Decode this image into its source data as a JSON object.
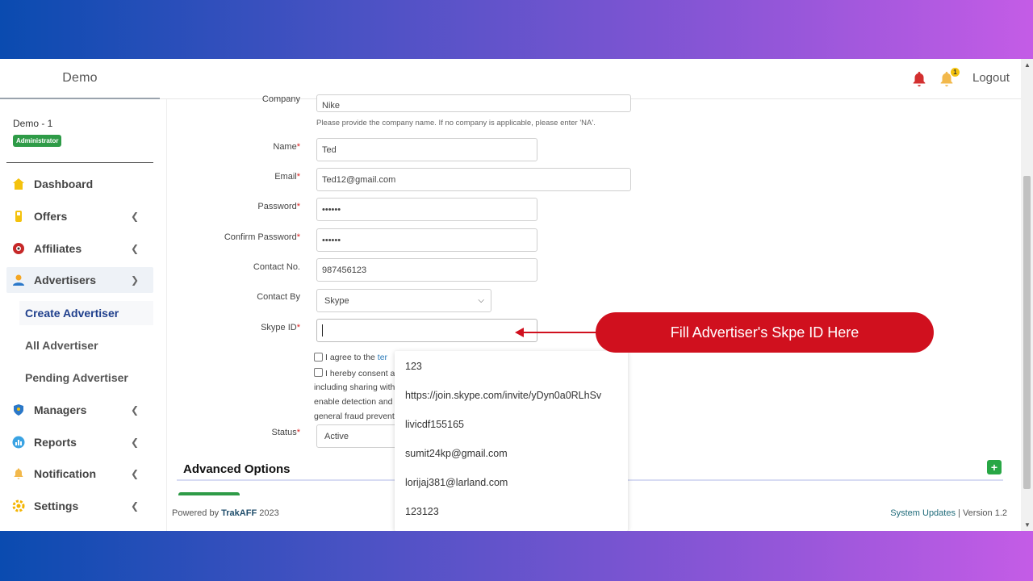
{
  "header": {
    "brand": "Demo",
    "notification_badge": "1",
    "logout_label": "Logout"
  },
  "sidebar": {
    "user_name": "Demo - 1",
    "role": "Administrator",
    "items": [
      {
        "label": "Dashboard",
        "icon": "home-icon"
      },
      {
        "label": "Offers",
        "icon": "offers-icon"
      },
      {
        "label": "Affiliates",
        "icon": "affiliates-icon"
      },
      {
        "label": "Advertisers",
        "icon": "advertiser-icon"
      },
      {
        "label": "Managers",
        "icon": "shield-icon"
      },
      {
        "label": "Reports",
        "icon": "chart-icon"
      },
      {
        "label": "Notification",
        "icon": "bell-icon"
      },
      {
        "label": "Settings",
        "icon": "gear-icon"
      }
    ],
    "sub_items": [
      {
        "label": "Create Advertiser"
      },
      {
        "label": "All Advertiser"
      },
      {
        "label": "Pending Advertiser"
      }
    ]
  },
  "form": {
    "company_label": "Company",
    "company_value": "Nike",
    "company_hint": "Please provide the company name. If no company is applicable, please enter 'NA'.",
    "name_label": "Name",
    "name_value": "Ted",
    "email_label": "Email",
    "email_value": "Ted12@gmail.com",
    "password_label": "Password",
    "password_value": "••••••",
    "confirm_label": "Confirm Password",
    "confirm_value": "••••••",
    "contact_label": "Contact No.",
    "contact_value": "987456123",
    "contact_by_label": "Contact By",
    "contact_by_value": "Skype",
    "skype_label": "Skype ID",
    "required_mark": "*",
    "terms_text": "I agree to the ",
    "terms_link": "ter",
    "consent_line1": "I hereby consent a",
    "consent_line2": "including sharing with",
    "consent_line3": "enable detection and",
    "consent_line4": "general fraud prevent",
    "status_label": "Status",
    "status_value": "Active"
  },
  "autocomplete": {
    "options": [
      "123",
      "https://join.skype.com/invite/yDyn0a0RLhSv",
      "livicdf155165",
      "sumit24kp@gmail.com",
      "lorijaj381@larland.com",
      "123123"
    ]
  },
  "advanced": {
    "title": "Advanced Options",
    "plus": "+"
  },
  "callout": {
    "text": "Fill Advertiser's Skpe ID Here",
    "color": "#d0101e"
  },
  "footer": {
    "powered_prefix": "Powered by ",
    "powered_brand": "TrakAFF",
    "powered_year": " 2023",
    "updates": "System Updates",
    "separator": " | ",
    "version": "Version 1.2"
  }
}
